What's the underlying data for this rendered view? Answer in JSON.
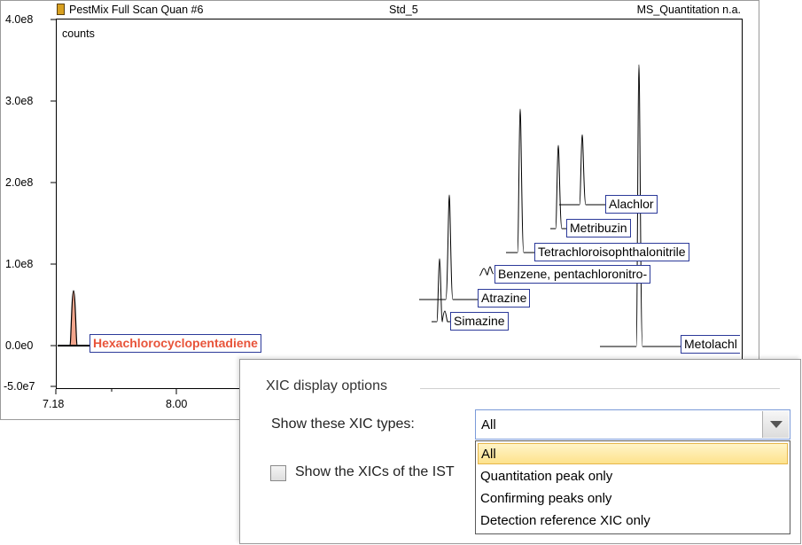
{
  "window": {
    "title_left": "PestMix Full Scan Quan #6",
    "title_center": "Std_5",
    "title_right": "MS_Quantitation n.a."
  },
  "plot": {
    "y_unit_label": "counts",
    "y_ticks": [
      "4.0e8",
      "3.0e8",
      "2.0e8",
      "1.0e8",
      "0.0e0",
      "-5.0e7"
    ],
    "x_ticks": [
      "7.18",
      "8.00"
    ],
    "peaks": [
      {
        "label": "Hexachlorocyclopentadiene",
        "highlighted": true
      },
      {
        "label": "Alachlor",
        "highlighted": false
      },
      {
        "label": "Metribuzin",
        "highlighted": false
      },
      {
        "label": "Tetrachloroisophthalonitrile",
        "highlighted": false
      },
      {
        "label": "Benzene, pentachloronitro-",
        "highlighted": false
      },
      {
        "label": "Atrazine",
        "highlighted": false
      },
      {
        "label": "Simazine",
        "highlighted": false
      },
      {
        "label": "Metolachl",
        "highlighted": false
      }
    ],
    "highlight_color": "#e8543a"
  },
  "options": {
    "group_title": "XIC display options",
    "types_label": "Show these XIC types:",
    "selected_value": "All",
    "dropdown_options": [
      "All",
      "Quantitation peak only",
      "Confirming peaks only",
      "Detection reference XIC only"
    ],
    "ist_label": "Show the XICs of the IST"
  }
}
